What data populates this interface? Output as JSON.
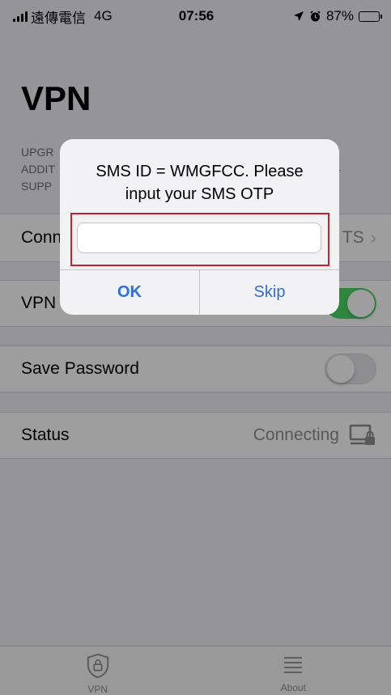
{
  "status_bar": {
    "carrier": "遠傳電信",
    "network": "4G",
    "time": "07:56",
    "battery": "87%",
    "battery_level": 0.87
  },
  "page": {
    "title": "VPN",
    "notice_lines": [
      "UPGR",
      "ADDIT",
      "SUPP"
    ],
    "notice_trailing": "-"
  },
  "rows": {
    "connection": {
      "label": "Conn",
      "value": "TS"
    },
    "vpn": {
      "label": "VPN",
      "enabled": true
    },
    "save_password": {
      "label": "Save Password",
      "enabled": false
    },
    "status": {
      "label": "Status",
      "value": "Connecting"
    }
  },
  "tabbar": {
    "tabs": [
      {
        "label": "VPN",
        "icon": "shield-lock-icon"
      },
      {
        "label": "About",
        "icon": "list-icon"
      }
    ]
  },
  "alert": {
    "message_line1": "SMS ID = WMGFCC. Please",
    "message_line2": "input your SMS OTP",
    "input_value": "",
    "input_placeholder": "",
    "ok_label": "OK",
    "skip_label": "Skip"
  },
  "colors": {
    "toggle_on": "#4cd964",
    "alert_button": "#2f6fd6",
    "highlight_border": "#c8202c"
  }
}
